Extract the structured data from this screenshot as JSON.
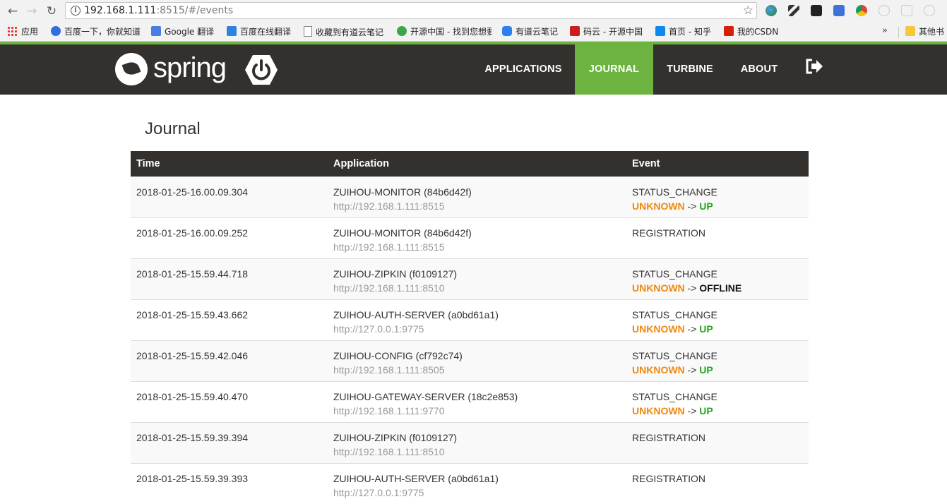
{
  "browser": {
    "url_host": "192.168.1.111",
    "url_rest": ":8515/#/events"
  },
  "bookmarks": [
    {
      "label": "应用",
      "icon": "apps-grid-icon",
      "color": "#e53935"
    },
    {
      "label": "百度一下，你就知道",
      "icon": "baidu-icon",
      "color": "#2f6fde"
    },
    {
      "label": "Google 翻译",
      "icon": "google-translate-icon",
      "color": "#4a7de0"
    },
    {
      "label": "百度在线翻译",
      "icon": "baidu-translate-icon",
      "color": "#2f82e0"
    },
    {
      "label": "收藏到有道云笔记",
      "icon": "page-icon",
      "color": "#ffffff"
    },
    {
      "label": "开源中国 - 找到您想要",
      "icon": "oschina-icon",
      "color": "#3aa54b"
    },
    {
      "label": "有道云笔记",
      "icon": "youdao-note-icon",
      "color": "#2d7ff0"
    },
    {
      "label": "码云 - 开源中国",
      "icon": "gitee-icon",
      "color": "#c71d23"
    },
    {
      "label": "首页 - 知乎",
      "icon": "zhihu-icon",
      "color": "#0f88eb"
    },
    {
      "label": "我的CSDN",
      "icon": "csdn-icon",
      "color": "#d81e06"
    },
    {
      "label": "其他书",
      "icon": "folder-icon",
      "color": "#f5c83b"
    }
  ],
  "header": {
    "logo_text": "spring",
    "nav": [
      {
        "label": "APPLICATIONS",
        "active": false
      },
      {
        "label": "JOURNAL",
        "active": true
      },
      {
        "label": "TURBINE",
        "active": false
      },
      {
        "label": "ABOUT",
        "active": false
      }
    ],
    "accent_color": "#6db33f"
  },
  "page": {
    "title": "Journal"
  },
  "table": {
    "headers": [
      "Time",
      "Application",
      "Event"
    ],
    "rows": [
      {
        "time": "2018-01-25-16.00.09.304",
        "app": "ZUIHOU-MONITOR (84b6d42f)",
        "url": "http://192.168.1.111:8515",
        "event": "STATUS_CHANGE",
        "from": "UNKNOWN",
        "arrow": "->",
        "to": "UP"
      },
      {
        "time": "2018-01-25-16.00.09.252",
        "app": "ZUIHOU-MONITOR (84b6d42f)",
        "url": "http://192.168.1.111:8515",
        "event": "REGISTRATION",
        "from": "",
        "arrow": "",
        "to": ""
      },
      {
        "time": "2018-01-25-15.59.44.718",
        "app": "ZUIHOU-ZIPKIN (f0109127)",
        "url": "http://192.168.1.111:8510",
        "event": "STATUS_CHANGE",
        "from": "UNKNOWN",
        "arrow": "->",
        "to": "OFFLINE"
      },
      {
        "time": "2018-01-25-15.59.43.662",
        "app": "ZUIHOU-AUTH-SERVER (a0bd61a1)",
        "url": "http://127.0.0.1:9775",
        "event": "STATUS_CHANGE",
        "from": "UNKNOWN",
        "arrow": "->",
        "to": "UP"
      },
      {
        "time": "2018-01-25-15.59.42.046",
        "app": "ZUIHOU-CONFIG (cf792c74)",
        "url": "http://192.168.1.111:8505",
        "event": "STATUS_CHANGE",
        "from": "UNKNOWN",
        "arrow": "->",
        "to": "UP"
      },
      {
        "time": "2018-01-25-15.59.40.470",
        "app": "ZUIHOU-GATEWAY-SERVER (18c2e853)",
        "url": "http://192.168.1.111:9770",
        "event": "STATUS_CHANGE",
        "from": "UNKNOWN",
        "arrow": "->",
        "to": "UP"
      },
      {
        "time": "2018-01-25-15.59.39.394",
        "app": "ZUIHOU-ZIPKIN (f0109127)",
        "url": "http://192.168.1.111:8510",
        "event": "REGISTRATION",
        "from": "",
        "arrow": "",
        "to": ""
      },
      {
        "time": "2018-01-25-15.59.39.393",
        "app": "ZUIHOU-AUTH-SERVER (a0bd61a1)",
        "url": "http://127.0.0.1:9775",
        "event": "REGISTRATION",
        "from": "",
        "arrow": "",
        "to": ""
      }
    ],
    "status_colors": {
      "UNKNOWN": "#f0870c",
      "UP": "#22a81a",
      "OFFLINE": "#111111"
    }
  }
}
